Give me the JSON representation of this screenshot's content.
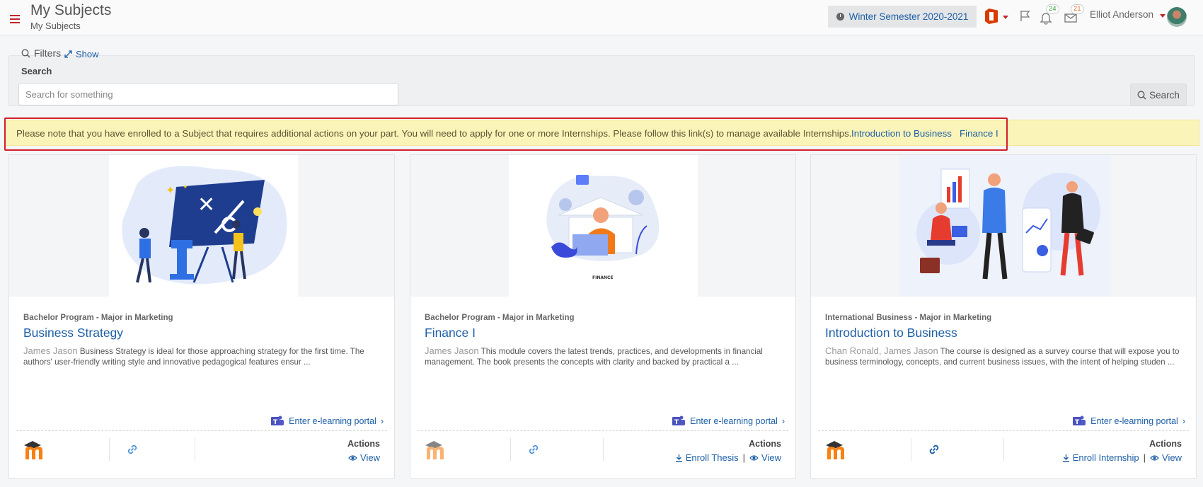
{
  "header": {
    "title": "My Subjects",
    "subtitle": "My Subjects",
    "semester": "Winter Semester 2020-2021",
    "notifications_count": "24",
    "messages_count": "21",
    "username": "Elliot Anderson"
  },
  "filters": {
    "title": "Filters",
    "show_label": "Show",
    "search_label": "Search",
    "search_placeholder": "Search for something",
    "search_button": "Search"
  },
  "alert": {
    "text": "Please note that you have enrolled to a Subject that requires additional actions on your part. You will need to apply for one or more Internships. Please follow this link(s) to manage available Internships.",
    "links": [
      "Introduction to Business",
      "Finance I"
    ]
  },
  "cards": [
    {
      "program": "Bachelor Program - Major in Marketing",
      "title": "Business Strategy",
      "authors": "James Jason",
      "description": "Business Strategy is ideal for those approaching strategy for the first time. The authors' user-friendly writing style and innovative pedagogical features ensur ...",
      "portal_label": "Enter e-learning portal",
      "actions_label": "Actions",
      "actions": [
        "View"
      ]
    },
    {
      "program": "Bachelor Program - Major in Marketing",
      "title": "Finance I",
      "authors": "James Jason",
      "description": "This module covers the latest trends, practices, and developments in financial management. The book presents the concepts with clarity and backed by practical a ...",
      "image_caption": "FINANCE",
      "portal_label": "Enter e-learning portal",
      "actions_label": "Actions",
      "actions": [
        "Enroll Thesis",
        "View"
      ]
    },
    {
      "program": "International Business - Major in Marketing",
      "title": "Introduction to Business",
      "authors": "Chan Ronald, James Jason",
      "description": "The course is designed as a survey course that will expose you to business terminology, concepts, and current business issues, with the intent of helping studen ...",
      "portal_label": "Enter e-learning portal",
      "actions_label": "Actions",
      "actions": [
        "Enroll Internship",
        "View"
      ]
    }
  ],
  "colors": {
    "accent": "#1d5fa6",
    "brand_red": "#c0272d",
    "alert_bg": "#fbf4b9",
    "alert_outline": "#d21f2b"
  },
  "icons": {
    "menu": "hamburger-icon",
    "semester": "clock-icon",
    "office": "office-icon",
    "flag": "flag-icon",
    "bell": "bell-icon",
    "mail": "envelope-icon",
    "search": "search-icon",
    "expand": "expand-icon",
    "teams": "teams-icon",
    "moodle": "moodle-icon",
    "link": "link-icon",
    "view": "eye-icon",
    "enroll": "download-icon"
  }
}
